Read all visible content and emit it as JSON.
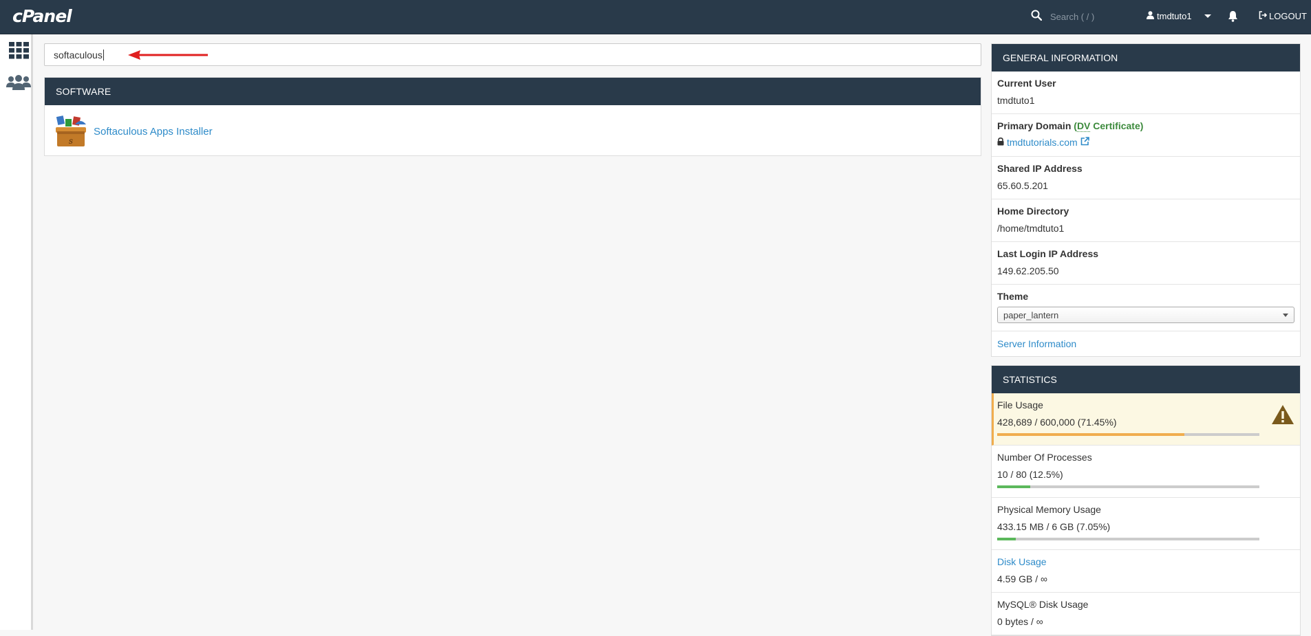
{
  "header": {
    "logo": "cPanel",
    "search_placeholder": "Search ( / )",
    "username": "tmdtuto1",
    "logout_label": "LOGOUT"
  },
  "search": {
    "value": "softaculous"
  },
  "software_panel": {
    "title": "SOFTWARE",
    "items": [
      {
        "label": "Softaculous Apps Installer",
        "icon": "softaculous-icon"
      }
    ]
  },
  "general_info": {
    "title": "GENERAL INFORMATION",
    "current_user_label": "Current User",
    "current_user": "tmdtuto1",
    "primary_domain_label": "Primary Domain",
    "cert_open": "(",
    "cert_abbr": "DV",
    "cert_rest": " Certificate)",
    "domain": "tmdtutorials.com",
    "shared_ip_label": "Shared IP Address",
    "shared_ip": "65.60.5.201",
    "home_dir_label": "Home Directory",
    "home_dir": "/home/tmdtuto1",
    "last_login_label": "Last Login IP Address",
    "last_login": "149.62.205.50",
    "theme_label": "Theme",
    "theme": "paper_lantern",
    "server_info_link": "Server Information"
  },
  "statistics": {
    "title": "STATISTICS",
    "rows": [
      {
        "label": "File Usage",
        "value": "428,689 / 600,000   (71.45%)",
        "fraction": 0.7145,
        "color": "#f0ad4e"
      },
      {
        "label": "Number Of Processes",
        "value": "10 / 80   (12.5%)",
        "fraction": 0.125,
        "color": "#5cb85c"
      },
      {
        "label": "Physical Memory Usage",
        "value": "433.15 MB / 6 GB   (7.05%)",
        "fraction": 0.0705,
        "color": "#5cb85c"
      },
      {
        "label": "Disk Usage",
        "value": "4.59 GB / ∞"
      },
      {
        "label": "MySQL® Disk Usage",
        "value": "0 bytes / ∞"
      }
    ]
  },
  "colors": {
    "topbar": "#293a4a",
    "link": "#2e8bc9",
    "warning": "#f0ad4e",
    "ok": "#5cb85c"
  }
}
